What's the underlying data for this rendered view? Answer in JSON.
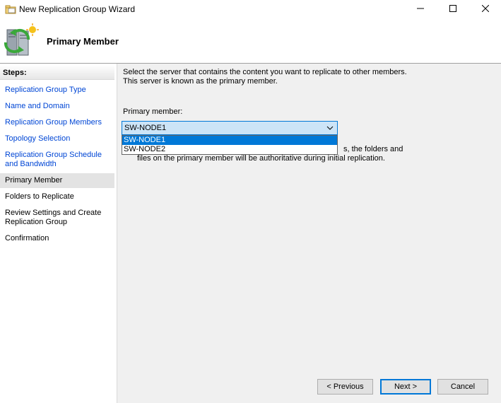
{
  "window": {
    "title": "New Replication Group Wizard",
    "icon": "replication-wizard-icon",
    "controls": [
      "minimize-icon",
      "maximize-icon",
      "close-icon"
    ]
  },
  "header": {
    "title": "Primary Member",
    "icon": "server-replication-icon"
  },
  "steps": {
    "heading": "Steps:",
    "items": [
      {
        "label": "Replication Group Type"
      },
      {
        "label": "Name and Domain"
      },
      {
        "label": "Replication Group Members"
      },
      {
        "label": "Topology Selection"
      },
      {
        "label_line1": "Replication Group Schedule",
        "label_line2": "and Bandwidth"
      },
      {
        "label": "Primary Member"
      },
      {
        "label": "Folders to Replicate"
      },
      {
        "label_line1": "Review Settings and Create",
        "label_line2": "Replication Group"
      },
      {
        "label": "Confirmation"
      }
    ]
  },
  "content": {
    "intro_line1": "Select the server that contains the content you want to replicate to other members.",
    "intro_line2": "This server is known as the primary member.",
    "primary_member_label": "Primary member:",
    "combo_value": "SW-NODE1",
    "options": [
      "SW-NODE1",
      "SW-NODE2"
    ],
    "note_line1_visible": "s, the folders and",
    "note_line2": "files on the primary member will be authoritative during initial replication."
  },
  "buttons": {
    "previous": "< Previous",
    "next": "Next >",
    "cancel": "Cancel"
  },
  "colors": {
    "link": "#0046d5",
    "selection": "#0078d7",
    "combo_bg": "#cce4f7",
    "active_step_bg": "#e3e3e3",
    "pane_bg": "#f0f0f0"
  }
}
